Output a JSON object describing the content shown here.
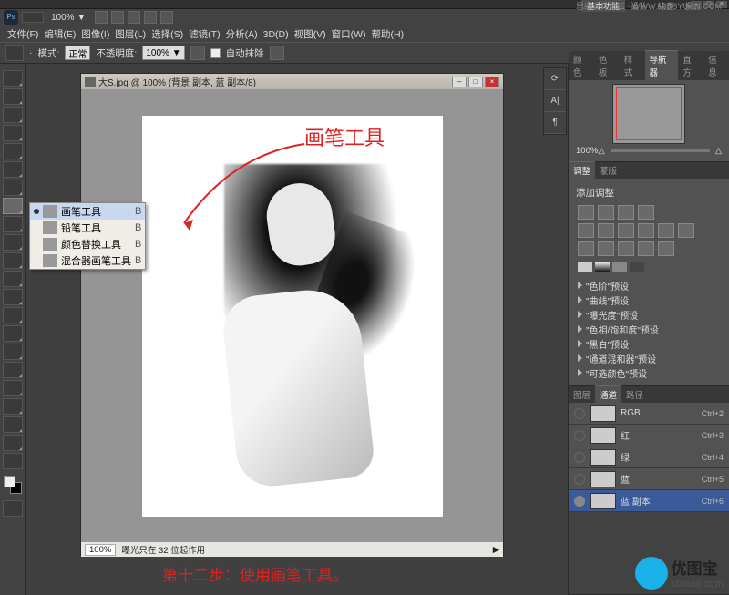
{
  "watermark": "思缘设计论坛 · WWW.MISSYUAN.COM",
  "titlebar": {
    "tabs": [
      "基本功能",
      "设计",
      "绘画",
      "摄影"
    ]
  },
  "topbar": {
    "zoom": "100% ▼"
  },
  "menus": [
    "文件(F)",
    "编辑(E)",
    "图像(I)",
    "图层(L)",
    "选择(S)",
    "滤镜(T)",
    "分析(A)",
    "3D(D)",
    "视图(V)",
    "窗口(W)",
    "帮助(H)"
  ],
  "options": {
    "mode_label": "模式:",
    "mode_value": "正常",
    "opacity_label": "不透明度:",
    "opacity_value": "100% ▼",
    "autoerase": "自动抹除"
  },
  "flyout": {
    "items": [
      {
        "label": "画笔工具",
        "key": "B",
        "active": true
      },
      {
        "label": "铅笔工具",
        "key": "B",
        "active": false
      },
      {
        "label": "颜色替换工具",
        "key": "B",
        "active": false
      },
      {
        "label": "混合器画笔工具",
        "key": "B",
        "active": false
      }
    ]
  },
  "doc": {
    "title": "大S.jpg @ 100% (背景 副本, 蓝 副本/8)",
    "zoom": "100%",
    "status": "曝光只在 32 位起作用"
  },
  "annotations": {
    "title": "画笔工具",
    "step": "第十二步：使用画笔工具。"
  },
  "panels": {
    "nav_tabs": [
      "颜色",
      "色板",
      "样式",
      "导航器",
      "直方",
      "信息"
    ],
    "nav_zoom": "100%",
    "adj_tabs": [
      "调整",
      "蒙版"
    ],
    "adj_title": "添加调整",
    "presets": [
      "\"色阶\"预设",
      "\"曲线\"预设",
      "\"曝光度\"预设",
      "\"色相/饱和度\"预设",
      "\"黑白\"预设",
      "\"通道混和器\"预设",
      "\"可选颜色\"预设"
    ],
    "chan_tabs": [
      "图层",
      "通道",
      "路径"
    ],
    "channels": [
      {
        "label": "RGB",
        "key": "Ctrl+2",
        "eye": false,
        "sel": false
      },
      {
        "label": "红",
        "key": "Ctrl+3",
        "eye": false,
        "sel": false
      },
      {
        "label": "绿",
        "key": "Ctrl+4",
        "eye": false,
        "sel": false
      },
      {
        "label": "蓝",
        "key": "Ctrl+5",
        "eye": false,
        "sel": false
      },
      {
        "label": "蓝 副本",
        "key": "Ctrl+6",
        "eye": true,
        "sel": true
      }
    ]
  },
  "brand": {
    "name": "优图宝",
    "url": "utobao.com"
  }
}
